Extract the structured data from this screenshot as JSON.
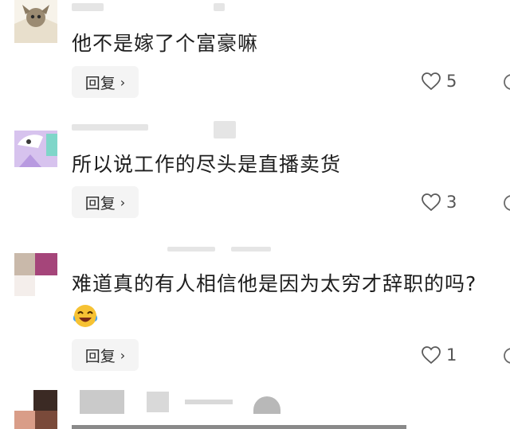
{
  "comments": [
    {
      "text": "他不是嫁了个富豪嘛",
      "reply_label": "回复",
      "likes": "5"
    },
    {
      "text": "所以说工作的尽头是直播卖货",
      "reply_label": "回复",
      "likes": "3"
    },
    {
      "text": "难道真的有人相信他是因为太穷才辞职的吗?",
      "emoji": "laughing-crying-emoji",
      "reply_label": "回复",
      "likes": "1"
    },
    {
      "text": ""
    }
  ],
  "icons": {
    "like": "heart-outline-icon",
    "reply_arrow": "chevron-right-icon"
  },
  "colors": {
    "reply_bg": "#f4f4f4",
    "text": "#1e1e1e",
    "count": "#555555"
  }
}
